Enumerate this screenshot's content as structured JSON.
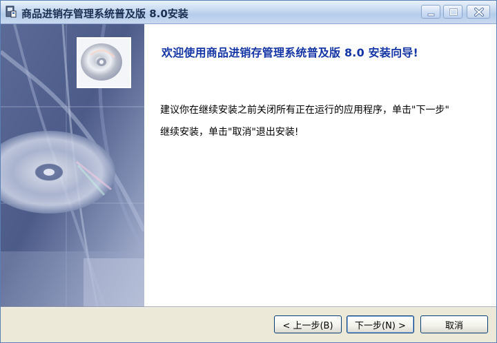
{
  "window": {
    "title": "商品进销存管理系统普及版 8.0安装"
  },
  "icons": {
    "app": "installer-app-icon",
    "cd": "cd-disc-icon",
    "minimize": "minimize-icon",
    "maximize": "maximize-icon",
    "close": "close-icon"
  },
  "main": {
    "heading": "欢迎使用商品进销存管理系统普及版 8.0 安装向导!",
    "paragraph_line1": "建议你在继续安装之前关闭所有正在运行的应用程序，单击\"下一步\"",
    "paragraph_line2": "继续安装，单击\"取消\"退出安装!"
  },
  "buttons": {
    "back": "< 上一步(B)",
    "next": "下一步(N) >",
    "cancel": "取消"
  },
  "colors": {
    "heading": "#1435a6",
    "title_bar": "#c9dbf1",
    "bottom_bar": "#ece9d8"
  }
}
